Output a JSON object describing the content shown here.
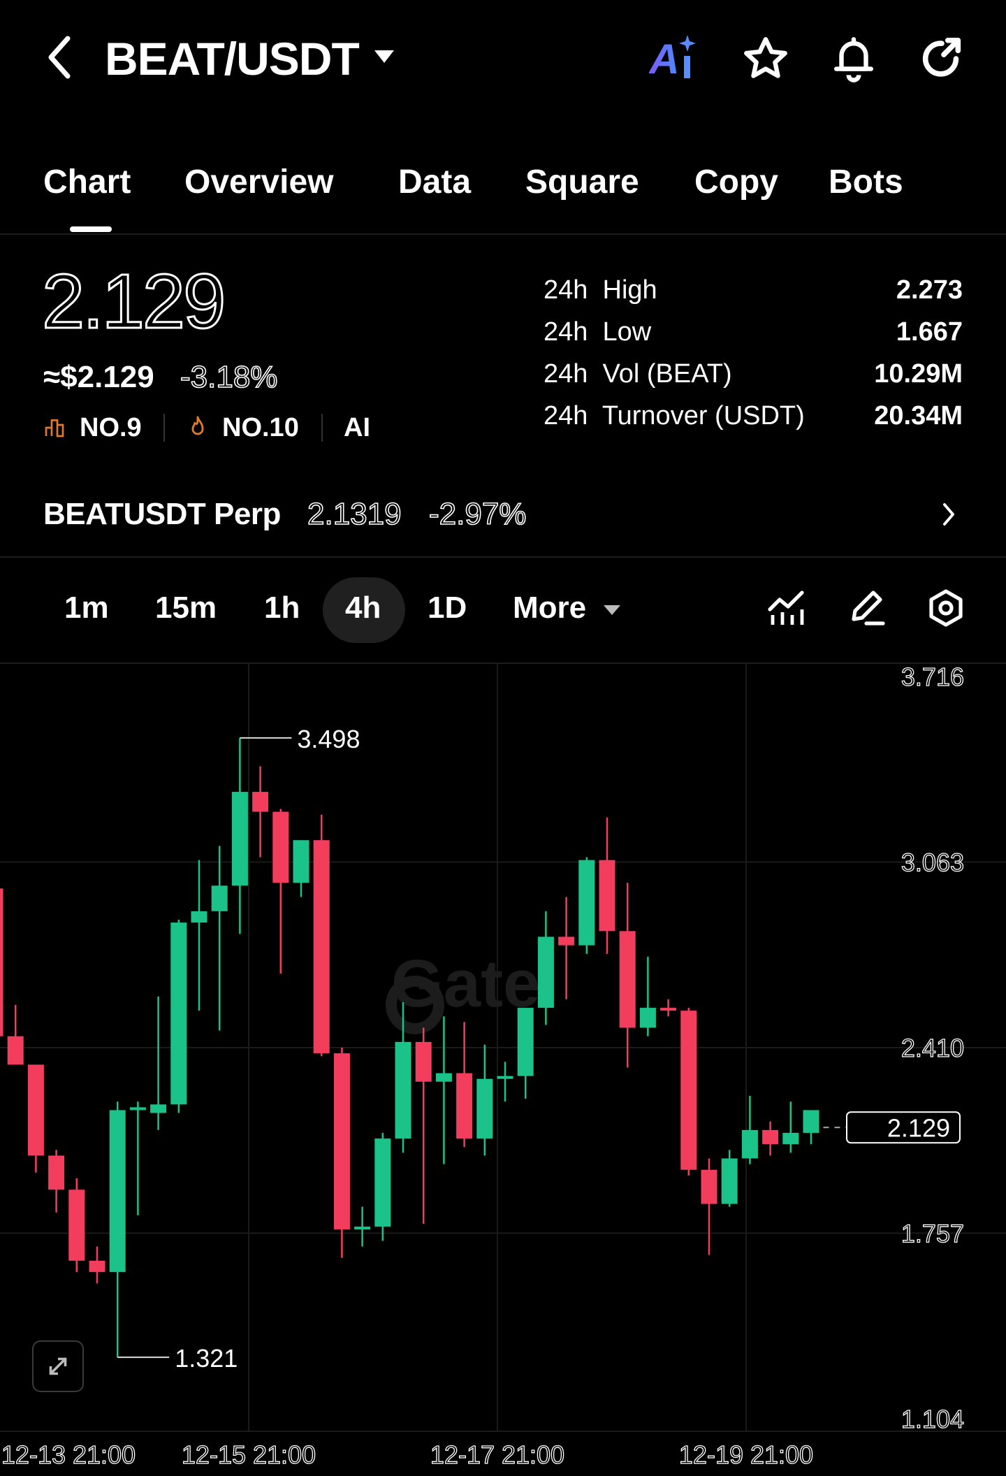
{
  "header": {
    "title": "BEAT/USDT"
  },
  "tabs": [
    {
      "label": "Chart"
    },
    {
      "label": "Overview"
    },
    {
      "label": "Data"
    },
    {
      "label": "Square"
    },
    {
      "label": "Copy"
    },
    {
      "label": "Bots"
    }
  ],
  "ticker": {
    "price": "2.129",
    "usd_price": "≈$2.129",
    "change": "-3.18%",
    "rank_1": "NO.9",
    "rank_2": "NO.10",
    "ai_label": "AI",
    "stats": [
      {
        "label": "24h  High",
        "value": "2.273"
      },
      {
        "label": "24h  Low",
        "value": "1.667"
      },
      {
        "label": "24h  Vol (BEAT)",
        "value": "10.29M"
      },
      {
        "label": "24h  Turnover (USDT)",
        "value": "20.34M"
      }
    ]
  },
  "perp": {
    "name": "BEATUSDT Perp",
    "price": "2.1319",
    "change": "-2.97%"
  },
  "intervals": [
    {
      "label": "1m"
    },
    {
      "label": "15m"
    },
    {
      "label": "1h"
    },
    {
      "label": "4h",
      "active": true
    },
    {
      "label": "1D"
    },
    {
      "label": "More"
    }
  ],
  "chart_data": {
    "type": "candlestick",
    "ylim": [
      1.104,
      3.716
    ],
    "y_ticks": [
      "3.716",
      "3.063",
      "2.410",
      "1.757",
      "1.104"
    ],
    "x_ticks": [
      "12-13 21:00",
      "12-15 21:00",
      "12-17 21:00",
      "12-19 21:00"
    ],
    "high_marker": "3.498",
    "low_marker": "1.321",
    "last_price": "2.129",
    "watermark": "Gate",
    "up_color": "#1bc38a",
    "down_color": "#f23d5d",
    "candles": [
      {
        "o": 2.97,
        "h": 2.99,
        "l": 2.44,
        "c": 2.45
      },
      {
        "o": 2.45,
        "h": 2.56,
        "l": 2.35,
        "c": 2.35
      },
      {
        "o": 2.35,
        "h": 2.35,
        "l": 1.97,
        "c": 2.03
      },
      {
        "o": 2.03,
        "h": 2.05,
        "l": 1.83,
        "c": 1.91
      },
      {
        "o": 1.91,
        "h": 1.95,
        "l": 1.62,
        "c": 1.66
      },
      {
        "o": 1.66,
        "h": 1.71,
        "l": 1.58,
        "c": 1.62
      },
      {
        "o": 1.62,
        "h": 2.22,
        "l": 1.32,
        "c": 2.19
      },
      {
        "o": 2.19,
        "h": 2.22,
        "l": 1.82,
        "c": 2.2
      },
      {
        "o": 2.18,
        "h": 2.59,
        "l": 2.12,
        "c": 2.21
      },
      {
        "o": 2.21,
        "h": 2.86,
        "l": 2.18,
        "c": 2.85
      },
      {
        "o": 2.85,
        "h": 3.07,
        "l": 2.54,
        "c": 2.89
      },
      {
        "o": 2.89,
        "h": 3.12,
        "l": 2.47,
        "c": 2.98
      },
      {
        "o": 2.98,
        "h": 3.5,
        "l": 2.81,
        "c": 3.31
      },
      {
        "o": 3.31,
        "h": 3.4,
        "l": 3.08,
        "c": 3.24
      },
      {
        "o": 3.24,
        "h": 3.25,
        "l": 2.67,
        "c": 2.99
      },
      {
        "o": 2.99,
        "h": 3.08,
        "l": 2.94,
        "c": 3.14
      },
      {
        "o": 3.14,
        "h": 3.23,
        "l": 2.38,
        "c": 2.39
      },
      {
        "o": 2.39,
        "h": 2.41,
        "l": 1.67,
        "c": 1.77
      },
      {
        "o": 1.77,
        "h": 1.85,
        "l": 1.71,
        "c": 1.78
      },
      {
        "o": 1.78,
        "h": 2.11,
        "l": 1.73,
        "c": 2.09
      },
      {
        "o": 2.09,
        "h": 2.57,
        "l": 2.04,
        "c": 2.43
      },
      {
        "o": 2.43,
        "h": 2.48,
        "l": 1.79,
        "c": 2.29
      },
      {
        "o": 2.29,
        "h": 2.52,
        "l": 2.0,
        "c": 2.32
      },
      {
        "o": 2.32,
        "h": 2.5,
        "l": 2.06,
        "c": 2.09
      },
      {
        "o": 2.09,
        "h": 2.42,
        "l": 2.03,
        "c": 2.3
      },
      {
        "o": 2.3,
        "h": 2.36,
        "l": 2.22,
        "c": 2.31
      },
      {
        "o": 2.31,
        "h": 2.51,
        "l": 2.23,
        "c": 2.55
      },
      {
        "o": 2.55,
        "h": 2.89,
        "l": 2.49,
        "c": 2.8
      },
      {
        "o": 2.8,
        "h": 2.94,
        "l": 2.58,
        "c": 2.77
      },
      {
        "o": 2.77,
        "h": 3.08,
        "l": 2.74,
        "c": 3.07
      },
      {
        "o": 3.07,
        "h": 3.22,
        "l": 2.74,
        "c": 2.82
      },
      {
        "o": 2.82,
        "h": 2.99,
        "l": 2.34,
        "c": 2.48
      },
      {
        "o": 2.48,
        "h": 2.73,
        "l": 2.45,
        "c": 2.55
      },
      {
        "o": 2.55,
        "h": 2.58,
        "l": 2.52,
        "c": 2.54
      },
      {
        "o": 2.54,
        "h": 2.55,
        "l": 1.96,
        "c": 1.98
      },
      {
        "o": 1.98,
        "h": 2.02,
        "l": 1.68,
        "c": 1.86
      },
      {
        "o": 1.86,
        "h": 2.05,
        "l": 1.85,
        "c": 2.02
      },
      {
        "o": 2.02,
        "h": 2.24,
        "l": 2.0,
        "c": 2.12
      },
      {
        "o": 2.12,
        "h": 2.15,
        "l": 2.03,
        "c": 2.07
      },
      {
        "o": 2.07,
        "h": 2.22,
        "l": 2.04,
        "c": 2.11
      },
      {
        "o": 2.11,
        "h": 2.18,
        "l": 2.07,
        "c": 2.19
      }
    ]
  }
}
